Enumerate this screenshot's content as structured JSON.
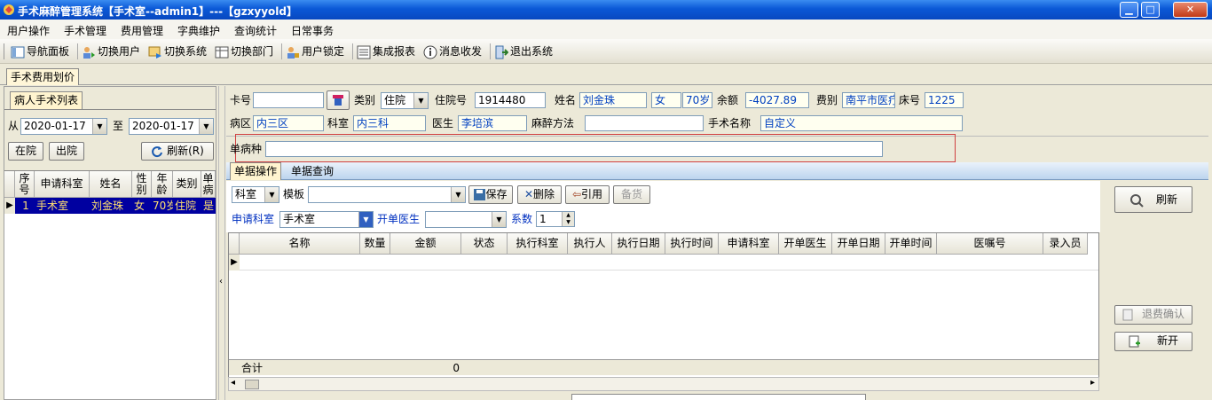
{
  "window": {
    "title": "手术麻醉管理系统【手术室--admin1】---【gzxyyold】",
    "min_icon": "minimize-icon",
    "max_icon": "maximize-icon",
    "close_icon": "close-icon",
    "min_glyph": "▁",
    "max_glyph": "□",
    "close_glyph": "✕"
  },
  "menu": [
    "用户操作",
    "手术管理",
    "费用管理",
    "字典维护",
    "查询统计",
    "日常事务"
  ],
  "toolbar": [
    {
      "label": "导航面板",
      "icon": "navigation-panel-icon"
    },
    {
      "label": "切换用户",
      "icon": "switch-user-icon"
    },
    {
      "label": "切换系统",
      "icon": "switch-system-icon"
    },
    {
      "label": "切换部门",
      "icon": "switch-department-icon"
    },
    {
      "label": "用户锁定",
      "icon": "user-lock-icon"
    },
    {
      "label": "集成报表",
      "icon": "report-icon"
    },
    {
      "label": "消息收发",
      "icon": "message-icon"
    },
    {
      "label": "退出系统",
      "icon": "exit-icon"
    }
  ],
  "main_tab": "手术费用划价",
  "left": {
    "title": "病人手术列表",
    "from_label": "从",
    "from_date": "2020-01-17",
    "to_label": "至",
    "to_date": "2020-01-17",
    "btn_in": "在院",
    "btn_out": "出院",
    "btn_refresh": "刷新(R)",
    "columns": [
      "序号",
      "申请科室",
      "姓名",
      "性别",
      "年龄",
      "类别",
      "单病"
    ],
    "rows": [
      [
        "1",
        "手术室",
        "刘金珠",
        "女",
        "70岁",
        "住院",
        "是"
      ]
    ]
  },
  "form": {
    "card_label": "卡号",
    "card_value": "",
    "type_label": "类别",
    "type_value": "住院",
    "admission_label": "住院号",
    "admission_value": "1914480",
    "name_label": "姓名",
    "name_value": "刘金珠",
    "gender_value": "女",
    "age_value": "70岁",
    "balance_label": "余额",
    "balance_value": "-4027.89",
    "fee_label": "费别",
    "fee_value": "南平市医疗",
    "bed_label": "床号",
    "bed_value": "1225",
    "ward_label": "病区",
    "ward_value": "内三区",
    "dept_label": "科室",
    "dept_value": "内三科",
    "doctor_label": "医生",
    "doctor_value": "李培滨",
    "anesthesia_label": "麻醉方法",
    "anesthesia_value": "",
    "surgery_label": "手术名称",
    "surgery_value": "自定义",
    "disease_label": "单病种",
    "disease_value": ""
  },
  "subtabs": [
    "单据操作",
    "单据查询"
  ],
  "ops": {
    "dept_combo": "科室",
    "template_label": "模板",
    "template_value": "",
    "save": "保存",
    "delete": "删除",
    "quote": "引用",
    "prepare": "备货",
    "req_dept_label": "申请科室",
    "req_dept_value": "手术室",
    "order_doctor_label": "开单医生",
    "order_doctor_value": "",
    "coef_label": "系数",
    "coef_value": "1"
  },
  "grid": {
    "columns": [
      "名称",
      "数量",
      "金额",
      "状态",
      "执行科室",
      "执行人",
      "执行日期",
      "执行时间",
      "申请科室",
      "开单医生",
      "开单日期",
      "开单时间",
      "医嘱号",
      "录入员"
    ],
    "total_label": "合计",
    "total_amount": "0"
  },
  "right_buttons": {
    "refresh": "刷新",
    "refund_confirm": "退费确认",
    "new_open": "新开"
  },
  "colors": {
    "title_blue": "#0a58d6",
    "highlight_row": "#0000a0",
    "label_blue": "#0030c0",
    "tab_yellow": "#fff4cf"
  }
}
